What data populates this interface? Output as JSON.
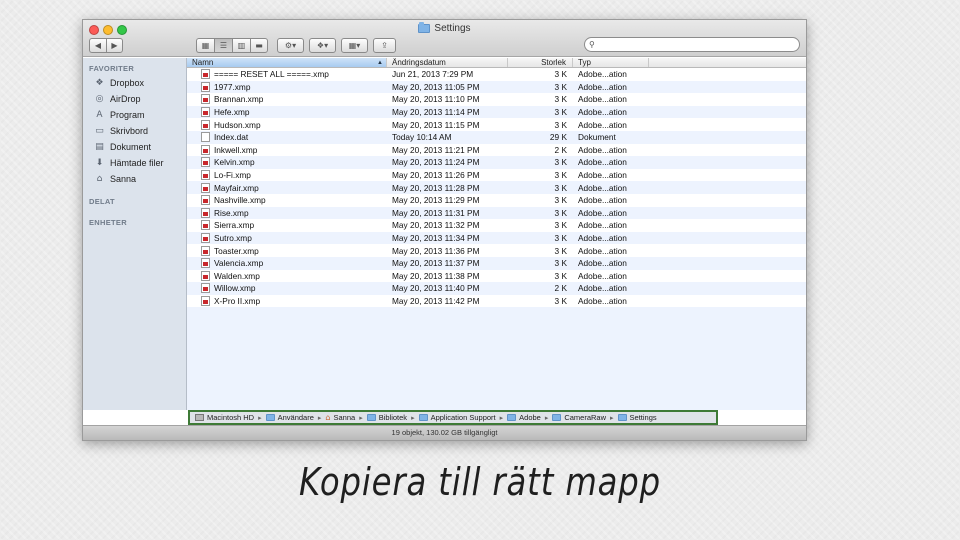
{
  "window": {
    "title": "Settings"
  },
  "toolbar": {
    "back_icon": "back-arrow-icon",
    "forward_icon": "forward-arrow-icon",
    "search_placeholder": "",
    "search_icon": "magnifier-icon"
  },
  "sidebar": {
    "sections": [
      {
        "title": "FAVORITER",
        "items": [
          {
            "label": "Dropbox",
            "icon": "dropbox-icon"
          },
          {
            "label": "AirDrop",
            "icon": "airdrop-icon"
          },
          {
            "label": "Program",
            "icon": "applications-icon"
          },
          {
            "label": "Skrivbord",
            "icon": "desktop-icon"
          },
          {
            "label": "Dokument",
            "icon": "documents-icon"
          },
          {
            "label": "Hämtade filer",
            "icon": "downloads-icon"
          },
          {
            "label": "Sanna",
            "icon": "home-icon"
          }
        ]
      },
      {
        "title": "DELAT",
        "items": []
      },
      {
        "title": "ENHETER",
        "items": []
      }
    ]
  },
  "columns": {
    "name": "Namn",
    "date": "Ändringsdatum",
    "size": "Storlek",
    "type": "Typ"
  },
  "files": [
    {
      "name": "===== RESET ALL =====.xmp",
      "date": "Jun 21, 2013 7:29 PM",
      "size": "3 K",
      "type": "Adobe...ation",
      "kind": "xmp"
    },
    {
      "name": "1977.xmp",
      "date": "May 20, 2013 11:05 PM",
      "size": "3 K",
      "type": "Adobe...ation",
      "kind": "xmp"
    },
    {
      "name": "Brannan.xmp",
      "date": "May 20, 2013 11:10 PM",
      "size": "3 K",
      "type": "Adobe...ation",
      "kind": "xmp"
    },
    {
      "name": "Hefe.xmp",
      "date": "May 20, 2013 11:14 PM",
      "size": "3 K",
      "type": "Adobe...ation",
      "kind": "xmp"
    },
    {
      "name": "Hudson.xmp",
      "date": "May 20, 2013 11:15 PM",
      "size": "3 K",
      "type": "Adobe...ation",
      "kind": "xmp"
    },
    {
      "name": "Index.dat",
      "date": "Today 10:14 AM",
      "size": "29 K",
      "type": "Dokument",
      "kind": "doc"
    },
    {
      "name": "Inkwell.xmp",
      "date": "May 20, 2013 11:21 PM",
      "size": "2 K",
      "type": "Adobe...ation",
      "kind": "xmp"
    },
    {
      "name": "Kelvin.xmp",
      "date": "May 20, 2013 11:24 PM",
      "size": "3 K",
      "type": "Adobe...ation",
      "kind": "xmp"
    },
    {
      "name": "Lo-Fi.xmp",
      "date": "May 20, 2013 11:26 PM",
      "size": "3 K",
      "type": "Adobe...ation",
      "kind": "xmp"
    },
    {
      "name": "Mayfair.xmp",
      "date": "May 20, 2013 11:28 PM",
      "size": "3 K",
      "type": "Adobe...ation",
      "kind": "xmp"
    },
    {
      "name": "Nashville.xmp",
      "date": "May 20, 2013 11:29 PM",
      "size": "3 K",
      "type": "Adobe...ation",
      "kind": "xmp"
    },
    {
      "name": "Rise.xmp",
      "date": "May 20, 2013 11:31 PM",
      "size": "3 K",
      "type": "Adobe...ation",
      "kind": "xmp"
    },
    {
      "name": "Sierra.xmp",
      "date": "May 20, 2013 11:32 PM",
      "size": "3 K",
      "type": "Adobe...ation",
      "kind": "xmp"
    },
    {
      "name": "Sutro.xmp",
      "date": "May 20, 2013 11:34 PM",
      "size": "3 K",
      "type": "Adobe...ation",
      "kind": "xmp"
    },
    {
      "name": "Toaster.xmp",
      "date": "May 20, 2013 11:36 PM",
      "size": "3 K",
      "type": "Adobe...ation",
      "kind": "xmp"
    },
    {
      "name": "Valencia.xmp",
      "date": "May 20, 2013 11:37 PM",
      "size": "3 K",
      "type": "Adobe...ation",
      "kind": "xmp"
    },
    {
      "name": "Walden.xmp",
      "date": "May 20, 2013 11:38 PM",
      "size": "3 K",
      "type": "Adobe...ation",
      "kind": "xmp"
    },
    {
      "name": "Willow.xmp",
      "date": "May 20, 2013 11:40 PM",
      "size": "2 K",
      "type": "Adobe...ation",
      "kind": "xmp"
    },
    {
      "name": "X-Pro II.xmp",
      "date": "May 20, 2013 11:42 PM",
      "size": "3 K",
      "type": "Adobe...ation",
      "kind": "xmp"
    }
  ],
  "pathbar": [
    {
      "label": "Macintosh HD",
      "icon": "hard-drive-icon"
    },
    {
      "label": "Användare",
      "icon": "folder-icon"
    },
    {
      "label": "Sanna",
      "icon": "home-icon"
    },
    {
      "label": "Bibliotek",
      "icon": "folder-icon"
    },
    {
      "label": "Application Support",
      "icon": "folder-icon"
    },
    {
      "label": "Adobe",
      "icon": "folder-icon"
    },
    {
      "label": "CameraRaw",
      "icon": "folder-icon"
    },
    {
      "label": "Settings",
      "icon": "folder-icon"
    }
  ],
  "status": "19 objekt, 130.02 GB tillgängligt",
  "caption": "Kopiera till rätt mapp"
}
